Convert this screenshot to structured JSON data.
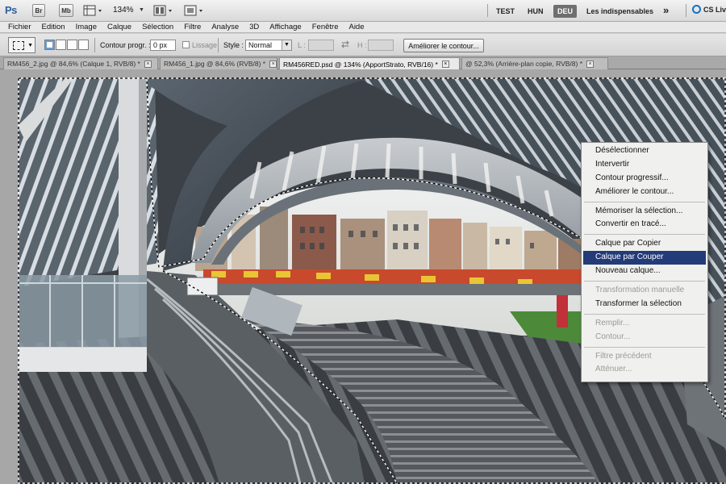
{
  "app": {
    "logo": "Ps",
    "bridge_label": "Br",
    "minibridge_label": "Mb",
    "zoom": "134%",
    "workspaces": [
      "TEST",
      "HUN",
      "DEU",
      "Les indispensables"
    ],
    "active_workspace": "DEU",
    "more": "»",
    "cslive": "CS Liv"
  },
  "menu": [
    "Fichier",
    "Edition",
    "Image",
    "Calque",
    "Sélection",
    "Filtre",
    "Analyse",
    "3D",
    "Affichage",
    "Fenêtre",
    "Aide"
  ],
  "options": {
    "feather_label": "Contour progr. :",
    "feather_value": "0 px",
    "antialias_label": "Lissage",
    "style_label": "Style :",
    "style_value": "Normal",
    "width_label": "L :",
    "height_label": "H :",
    "swap_icon": "⇄",
    "refine_edge": "Améliorer le contour..."
  },
  "tabs": [
    {
      "label": "RM456_2.jpg @ 84,6% (Calque 1, RVB/8) *",
      "close": "×"
    },
    {
      "label": "RM456_1.jpg @ 84,6% (RVB/8) *",
      "close": "×"
    },
    {
      "label": "RM456RED.psd @ 134% (ApportStrato, RVB/16) *",
      "close": "×"
    },
    {
      "label": "@ 52,3% (Arrière-plan copie, RVB/8) *",
      "close": "×"
    }
  ],
  "active_tab": 2,
  "context_menu": {
    "groups": [
      [
        "Désélectionner",
        "Intervertir",
        "Contour progressif...",
        "Améliorer le contour..."
      ],
      [
        "Mémoriser la sélection...",
        "Convertir en tracé..."
      ],
      [
        "Calque par Copier",
        "Calque par Couper",
        "Nouveau calque..."
      ],
      [
        "Transformation manuelle",
        "Transformer la sélection"
      ],
      [
        "Remplir...",
        "Contour..."
      ],
      [
        "Filtre précédent",
        "Atténuer..."
      ]
    ],
    "highlighted": "Calque par Couper",
    "disabled": [
      "Transformation manuelle",
      "Remplir...",
      "Contour...",
      "Filtre précédent",
      "Atténuer..."
    ]
  },
  "colors": {
    "menu_highlight": "#233b78",
    "active_workspace_bg": "#6f6f6f"
  }
}
